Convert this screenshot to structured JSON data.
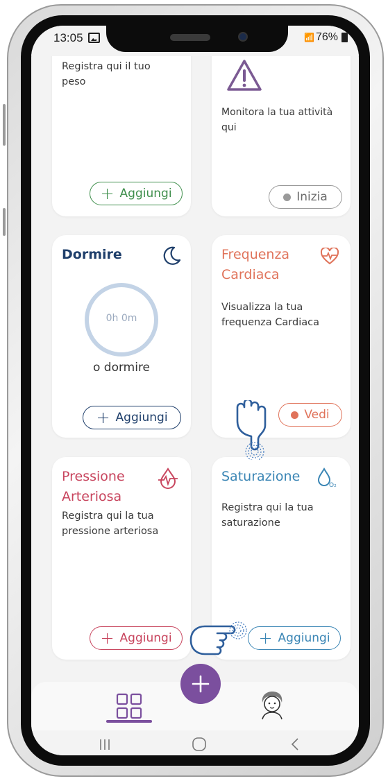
{
  "status": {
    "time": "13:05",
    "battery": "76%"
  },
  "cards": {
    "weight": {
      "desc": "Registra qui il tuo peso",
      "button": "Aggiungi",
      "color": "#3f8f4c"
    },
    "activity": {
      "desc": "Monitora la tua attività qui",
      "button": "Inizia",
      "color": "#7b5a93"
    },
    "sleep": {
      "title": "Dormire",
      "ring_text": "0h 0m",
      "subtitle": "o dormire",
      "button": "Aggiungi",
      "color": "#1f3f6b"
    },
    "heart": {
      "title_line1": "Frequenza",
      "title_line2": "Cardiaca",
      "desc": "Visualizza la tua frequenza Cardiaca",
      "button": "Vedi",
      "color": "#e0735a"
    },
    "pressure": {
      "title_line1": "Pressione",
      "title_line2": "Arteriosa",
      "desc": "Registra qui la tua pressione arteriosa",
      "button": "Aggiungi",
      "color": "#c8455e"
    },
    "saturation": {
      "title": "Saturazione",
      "desc": "Registra qui la tua saturazione",
      "button": "Aggiungi",
      "color": "#3b86b5"
    }
  },
  "nav": {
    "accent": "#7b4f9e",
    "items": [
      "dashboard-icon",
      "add-icon",
      "profile-icon"
    ]
  }
}
